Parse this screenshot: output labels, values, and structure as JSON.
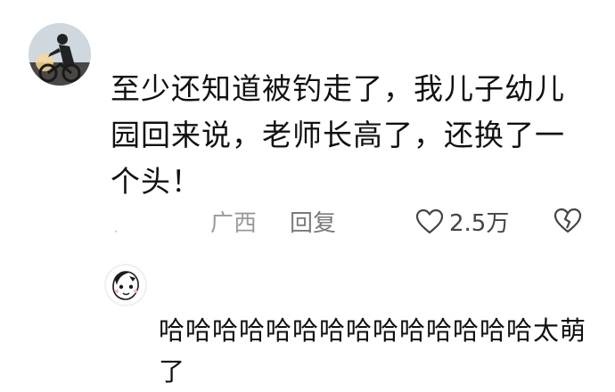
{
  "comment": {
    "text": "至少还知道被钓走了，我儿子幼儿园回来说，老师长高了，还换了一个头！",
    "dot": "·",
    "location": "广西",
    "reply_label": "回复",
    "like_count": "2.5万"
  },
  "reply": {
    "text": "哈哈哈哈哈哈哈哈哈哈哈哈哈哈太萌了"
  },
  "icons": {
    "like": "heart-outline-icon",
    "dislike": "broken-heart-icon"
  }
}
